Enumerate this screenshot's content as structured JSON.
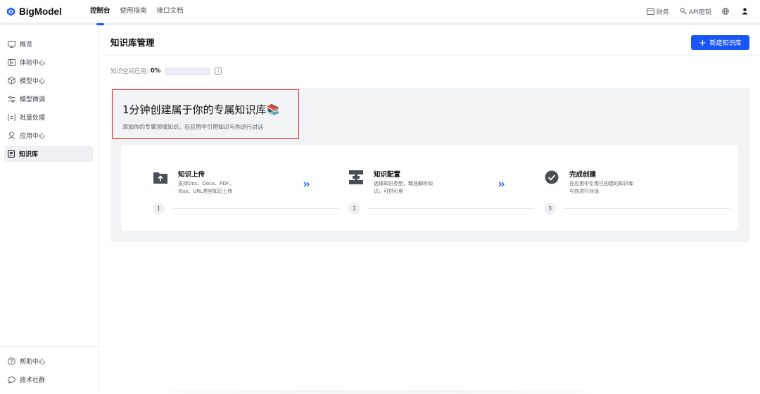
{
  "app": {
    "name": "BigModel"
  },
  "nav": {
    "items": [
      "控制台",
      "使用指南",
      "接口文档"
    ],
    "active": 0
  },
  "topRight": {
    "finance": "财务",
    "apiKey": "API密钥"
  },
  "sidebar": {
    "items": [
      {
        "label": "概览",
        "icon": "monitor-icon"
      },
      {
        "label": "体验中心",
        "icon": "play-box-icon"
      },
      {
        "label": "模型中心",
        "icon": "cube-icon"
      },
      {
        "label": "模型微调",
        "icon": "tune-icon"
      },
      {
        "label": "批量处理",
        "icon": "list-bracket-icon"
      },
      {
        "label": "应用中心",
        "icon": "app-icon"
      },
      {
        "label": "知识库",
        "icon": "document-icon",
        "active": true
      }
    ],
    "bottom": [
      {
        "label": "帮助中心",
        "icon": "help-icon"
      },
      {
        "label": "技术社群",
        "icon": "chat-icon"
      }
    ]
  },
  "page": {
    "title": "知识库管理",
    "newButton": "新建知识库",
    "usage": {
      "label": "知识空间已用:",
      "percent": "0%",
      "fraction": 0
    }
  },
  "hero": {
    "title": "1分钟创建属于你的专属知识库📚",
    "subtitle": "添加你的专属领域知识，在应用中引用知识与你进行对话"
  },
  "steps": [
    {
      "number": "1",
      "title": "知识上传",
      "desc": "支持Doc、Docx、PDF、Xlsx、URL类型知识上传",
      "icon": "upload-folder-icon"
    },
    {
      "number": "2",
      "title": "知识配置",
      "desc": "选择知识类型，精准解析知识，可供引用",
      "icon": "config-icon"
    },
    {
      "number": "3",
      "title": "完成创建",
      "desc": "在应用中引用已创建的知识库与你进行对话",
      "icon": "check-circle-icon"
    }
  ],
  "colors": {
    "accent": "#1a56f5",
    "highlightBorder": "#e0262b",
    "cardBg": "#f2f3f5"
  }
}
